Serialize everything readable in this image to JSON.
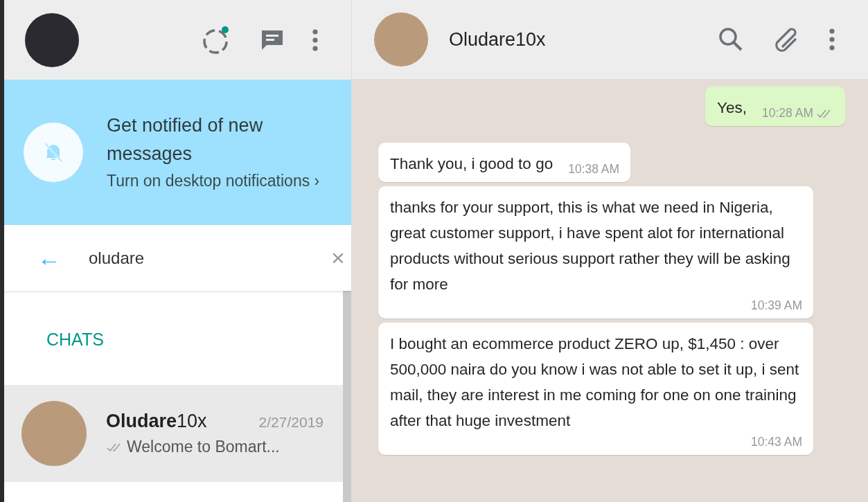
{
  "sidebar": {
    "banner": {
      "title": "Get notified of new messages",
      "link": "Turn on desktop notifications",
      "chevron": "›"
    },
    "search": {
      "back": "←",
      "value": "oludare",
      "clear": "×"
    },
    "section_label": "CHATS",
    "chats": [
      {
        "name": "**Oludare**10x",
        "date": "2/27/2019",
        "preview": "Welcome to Bomart...",
        "ticks": true,
        "selected": true
      }
    ]
  },
  "chat": {
    "title": "Oludare10x",
    "messages": [
      {
        "kind": "out",
        "text": "Yes,",
        "time": "10:28 AM",
        "ticks": true
      },
      {
        "kind": "in",
        "text": "Thank you, i good to go",
        "time": "10:38 AM",
        "ticks": false
      },
      {
        "kind": "in",
        "text": "thanks for your support, this is what we need in Nigeria, great customer support, i have spent alot for international products without serious support  rather they will be asking for more",
        "time": "10:39 AM",
        "ticks": false
      },
      {
        "kind": "in",
        "text": "I bought an ecommerce product ZERO up, $1,450 : over 500,000 naira do you know i was not able to set it up, i sent mail, they are interest in me coming for one on one training after that huge investment",
        "time": "10:43 AM",
        "ticks": false
      }
    ]
  }
}
